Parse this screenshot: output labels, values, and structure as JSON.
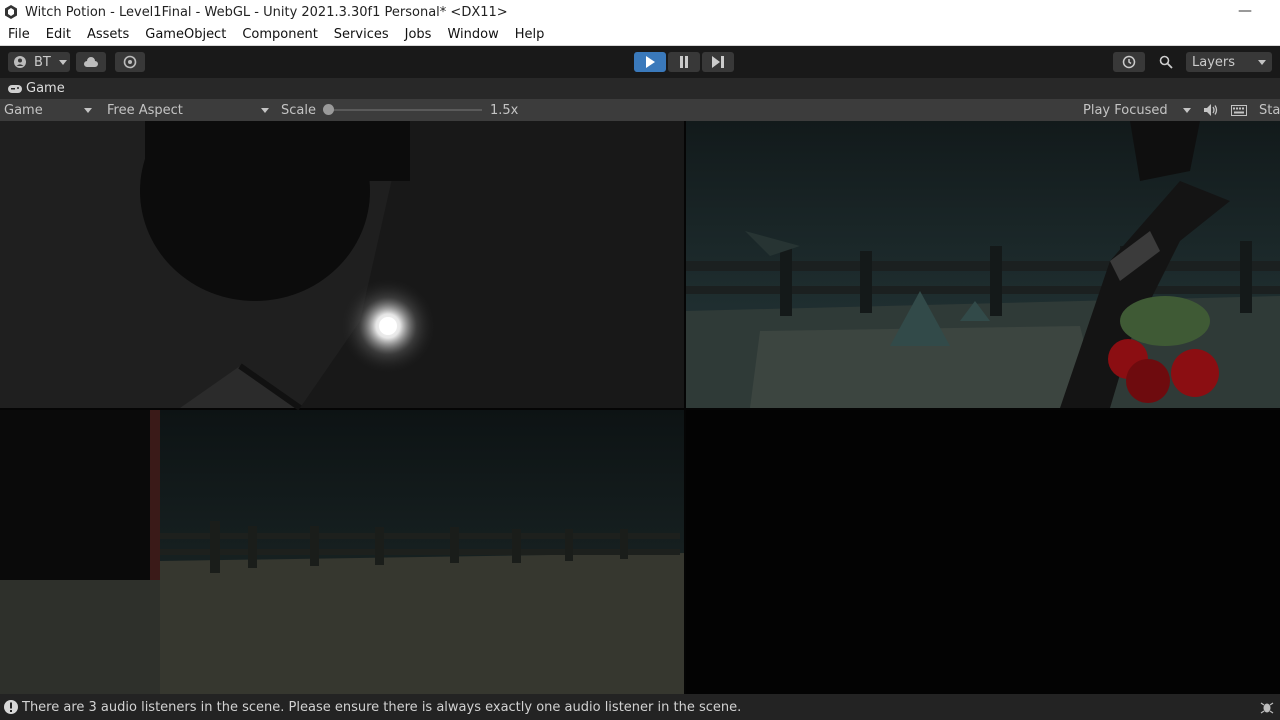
{
  "window": {
    "title": "Witch Potion - Level1Final - WebGL - Unity 2021.3.30f1 Personal* <DX11>"
  },
  "menu": [
    "File",
    "Edit",
    "Assets",
    "GameObject",
    "Component",
    "Services",
    "Jobs",
    "Window",
    "Help"
  ],
  "toolbar": {
    "account": "BT",
    "layers": "Layers",
    "accent": "#3a79bb"
  },
  "tab": {
    "label": "Game"
  },
  "gamebar": {
    "display": "Game",
    "aspect": "Free Aspect",
    "scale_label": "Scale",
    "scale_value": "1.5x",
    "play_mode": "Play Focused",
    "stats": "Sta"
  },
  "status": {
    "message": "There are 3 audio listeners in the scene. Please ensure there is always exactly one audio listener in the scene."
  }
}
